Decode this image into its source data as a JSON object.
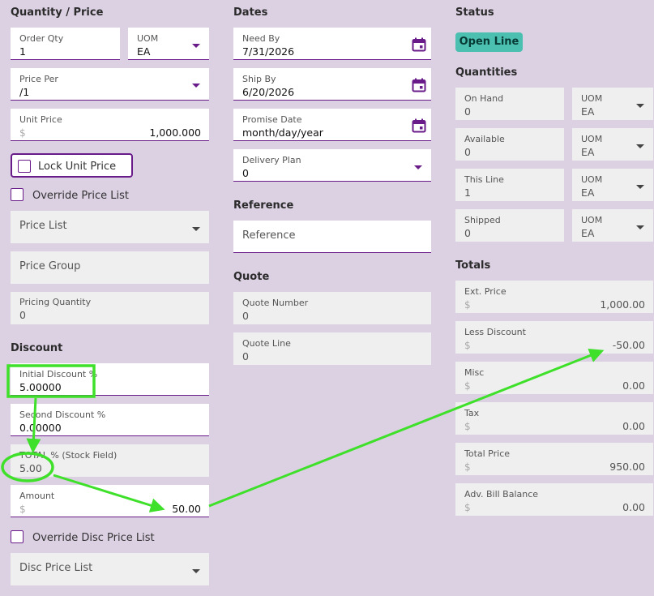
{
  "headings": {
    "qty_price": "Quantity / Price",
    "dates": "Dates",
    "status": "Status",
    "quantities": "Quantities",
    "discount": "Discount",
    "reference": "Reference",
    "quote": "Quote",
    "totals": "Totals"
  },
  "status": {
    "badge": "Open Line"
  },
  "currency_symbol": "$",
  "qty_price": {
    "order_qty": {
      "label": "Order Qty",
      "value": "1"
    },
    "uom": {
      "label": "UOM",
      "value": "EA"
    },
    "price_per": {
      "label": "Price Per",
      "value": "/1"
    },
    "unit_price": {
      "label": "Unit Price",
      "value": "1,000.000"
    },
    "lock_unit_price": "Lock Unit Price",
    "override_price_list": "Override Price List",
    "price_list": "Price List",
    "price_group": "Price Group",
    "pricing_quantity": {
      "label": "Pricing Quantity",
      "value": "0"
    }
  },
  "discount": {
    "initial": {
      "label": "Initial Discount %",
      "value": "5.00000"
    },
    "second": {
      "label": "Second Discount %",
      "value": "0.00000"
    },
    "total": {
      "label": "TOTAL % (Stock Field)",
      "value": "5.00"
    },
    "amount": {
      "label": "Amount",
      "value": "50.00"
    },
    "override_disc_price_list": "Override Disc Price List",
    "disc_price_list": "Disc Price List"
  },
  "dates": {
    "need_by": {
      "label": "Need By",
      "value": "7/31/2026"
    },
    "ship_by": {
      "label": "Ship By",
      "value": "6/20/2026"
    },
    "promise_date": {
      "label": "Promise Date",
      "value": "month/day/year"
    },
    "delivery_plan": {
      "label": "Delivery Plan",
      "value": "0"
    }
  },
  "reference": {
    "placeholder": "Reference"
  },
  "quote": {
    "number": {
      "label": "Quote Number",
      "value": "0"
    },
    "line": {
      "label": "Quote Line",
      "value": "0"
    }
  },
  "quantities": [
    {
      "label": "On Hand",
      "value": "0",
      "uom_label": "UOM",
      "uom": "EA"
    },
    {
      "label": "Available",
      "value": "0",
      "uom_label": "UOM",
      "uom": "EA"
    },
    {
      "label": "This Line",
      "value": "1",
      "uom_label": "UOM",
      "uom": "EA"
    },
    {
      "label": "Shipped",
      "value": "0",
      "uom_label": "UOM",
      "uom": "EA"
    }
  ],
  "totals": {
    "ext_price": {
      "label": "Ext. Price",
      "value": "1,000.00"
    },
    "less_discount": {
      "label": "Less Discount",
      "value": "-50.00"
    },
    "misc": {
      "label": "Misc",
      "value": "0.00"
    },
    "tax": {
      "label": "Tax",
      "value": "0.00"
    },
    "total_price": {
      "label": "Total Price",
      "value": "950.00"
    },
    "adv_bill_balance": {
      "label": "Adv. Bill Balance",
      "value": "0.00"
    }
  },
  "colors": {
    "background": "#dcd0e3",
    "accent": "#6a1b8a",
    "status_badge": "#4bbfb0",
    "annotation": "#3ee02a"
  }
}
